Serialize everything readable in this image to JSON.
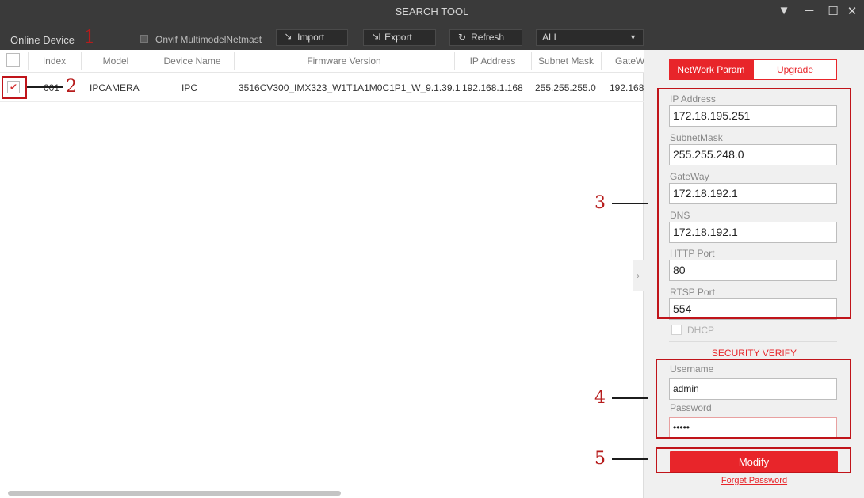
{
  "window": {
    "title": "SEARCH TOOL",
    "controls": {
      "menu": "▼",
      "minimize": "─",
      "maximize": "☐",
      "close": "✕"
    }
  },
  "toolbar": {
    "online_device": "Online Device",
    "onvif_label": "Onvif MultimodelNetmast",
    "import_label": "Import",
    "export_label": "Export",
    "refresh_label": "Refresh",
    "filter_value": "ALL"
  },
  "table": {
    "columns": [
      "Index",
      "Model",
      "Device Name",
      "Firmware Version",
      "IP Address",
      "Subnet Mask",
      "GateW"
    ],
    "rows": [
      {
        "checked": true,
        "index": "001",
        "model": "IPCAMERA",
        "device_name": "IPC",
        "firmware": "3516CV300_IMX323_W1T1A1M0C1P1_W_9.1.39.1",
        "ip": "192.168.1.168",
        "subnet": "255.255.255.0",
        "gateway": "192.168."
      }
    ]
  },
  "panel": {
    "tab_network": "NetWork Param",
    "tab_upgrade": "Upgrade",
    "fields": {
      "ip_label": "IP Address",
      "ip_value": "172.18.195.251",
      "subnet_label": "SubnetMask",
      "subnet_value": "255.255.248.0",
      "gateway_label": "GateWay",
      "gateway_value": "172.18.192.1",
      "dns_label": "DNS",
      "dns_value": "172.18.192.1",
      "http_label": "HTTP Port",
      "http_value": "80",
      "rtsp_label": "RTSP Port",
      "rtsp_value": "554"
    },
    "dhcp_label": "DHCP",
    "security_title": "SECURITY VERIFY",
    "username_label": "Username",
    "username_value": "admin",
    "password_label": "Password",
    "password_value": "•••••",
    "modify_label": "Modify",
    "forget_label": "Forget Password"
  },
  "annotations": [
    "1",
    "2",
    "3",
    "4",
    "5"
  ],
  "colors": {
    "accent": "#e8252a",
    "annotation": "#c0141a",
    "titlebar": "#3a3a3a"
  }
}
